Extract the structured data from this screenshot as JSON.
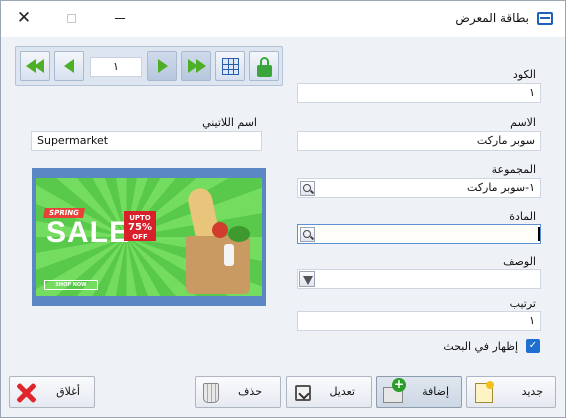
{
  "window": {
    "title": "بطاقة المعرض",
    "close_glyph": "✕"
  },
  "nav": {
    "page": "١"
  },
  "form": {
    "code_label": "الكود",
    "code_value": "١",
    "name_label": "الاسم",
    "name_value": "سوبر ماركت",
    "latin_label": "اسم اللاتيني",
    "latin_value": "Supermarket",
    "group_label": "المجموعة",
    "group_value": "١-سوبر ماركت",
    "item_label": "المادة",
    "item_value": "",
    "desc_label": "الوصف",
    "desc_value": "",
    "order_label": "ترتيب",
    "order_value": "١",
    "show_in_search_label": "إظهار في البحث",
    "show_in_search_checked": true
  },
  "banner": {
    "spring": "SPRING",
    "sale": "SALE",
    "upto": "UPTO",
    "percent": "75%",
    "off": "OFF",
    "shop_now": "SHOP NOW"
  },
  "buttons": {
    "new": "جديد",
    "add": "إضافة",
    "edit": "تعديل",
    "delete": "حذف",
    "close": "أغلاق"
  },
  "colors": {
    "accent": "#1f6fd1",
    "nav_arrow": "#4caf25",
    "close_icon": "#e0252b"
  }
}
